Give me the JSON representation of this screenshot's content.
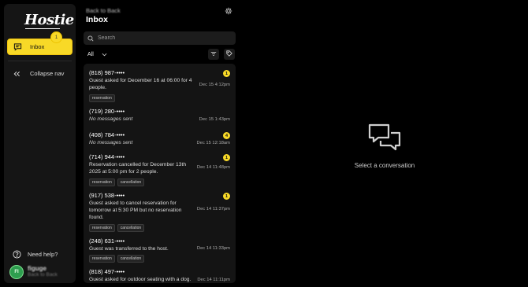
{
  "app": {
    "logo_text": "Hostie"
  },
  "sidebar": {
    "inbox_label": "Inbox",
    "inbox_badge": "1",
    "collapse_label": "Collapse nav",
    "help_label": "Need help?",
    "user": {
      "initials": "FI",
      "name": "figuge",
      "org": "Back to Back"
    }
  },
  "header": {
    "subtitle": "Back to Back",
    "title": "Inbox"
  },
  "search": {
    "placeholder": "Search",
    "value": ""
  },
  "filter": {
    "selected": "All"
  },
  "conversations": [
    {
      "phone": "(818) 987-••••",
      "message": "Guest asked for December 16 at 06:00 for 4 people.",
      "timestamp": "Dec 15 4:12pm",
      "unread": "1",
      "tags": [
        "reservation"
      ],
      "empty": false
    },
    {
      "phone": "(719) 280-••••",
      "message": "No messages sent",
      "timestamp": "Dec 15 1:43pm",
      "unread": "",
      "tags": [],
      "empty": true
    },
    {
      "phone": "(408) 784-••••",
      "message": "No messages sent",
      "timestamp": "Dec 15 12:18am",
      "unread": "4",
      "tags": [],
      "empty": true
    },
    {
      "phone": "(714) 944-••••",
      "message": "Reservation cancelled for December 13th 2025 at 5:00 pm for 2 people.",
      "timestamp": "Dec 14 11:48pm",
      "unread": "1",
      "tags": [
        "reservation",
        "cancellation"
      ],
      "empty": false
    },
    {
      "phone": "(917) 538-••••",
      "message": "Guest asked to cancel reservation for tomorrow at 5:30 PM but no reservation found.",
      "timestamp": "Dec 14 11:37pm",
      "unread": "1",
      "tags": [
        "reservation",
        "cancellation"
      ],
      "empty": false
    },
    {
      "phone": "(248) 631-••••",
      "message": "Guest was transferred to the host.",
      "timestamp": "Dec 14 11:33pm",
      "unread": "",
      "tags": [
        "reservation",
        "cancellation"
      ],
      "empty": false
    },
    {
      "phone": "(818) 497-••••",
      "message": "Guest asked for outdoor seating with a dog.",
      "timestamp": "Dec 14 11:11pm",
      "unread": "",
      "tags": [],
      "empty": false
    }
  ],
  "empty_state": {
    "label": "Select a conversation",
    "icon": "chat-bubbles-icon"
  },
  "colors": {
    "accent": "#f8d927",
    "background": "#000000",
    "panel": "#151515"
  }
}
